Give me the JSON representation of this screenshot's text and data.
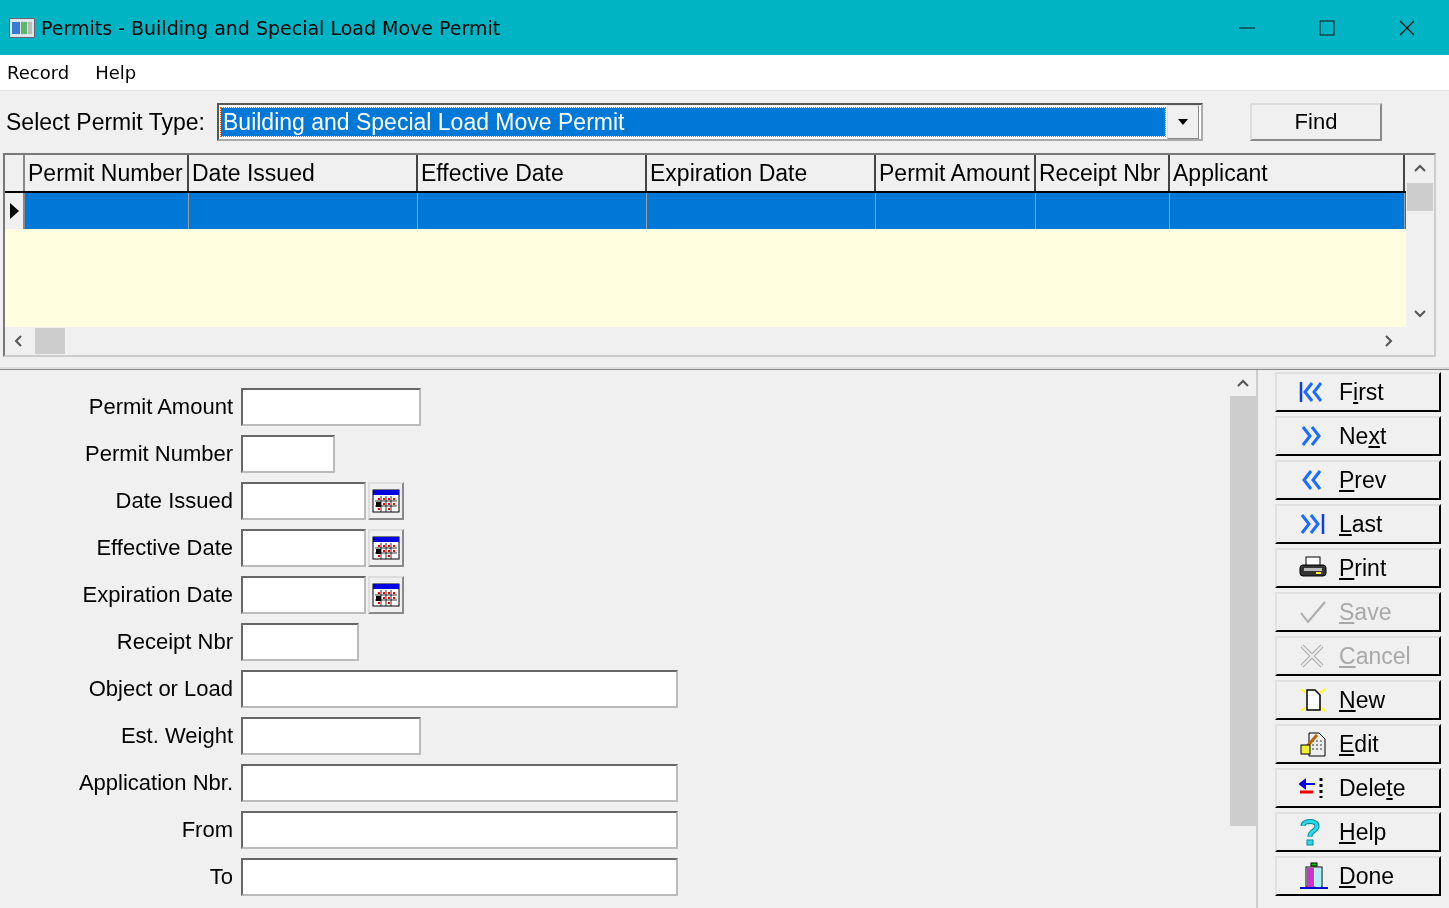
{
  "window": {
    "title": "Permits - Building and Special Load Move Permit"
  },
  "menu": [
    "Record",
    "Help"
  ],
  "permit_type": {
    "label": "Select Permit Type:",
    "value": "Building and Special Load Move Permit"
  },
  "find_button": "Find",
  "table": {
    "columns": [
      "Permit Number",
      "Date Issued",
      "Effective Date",
      "Expiration Date",
      "Permit Amount",
      "Receipt Nbr",
      "Applicant"
    ],
    "rows": [
      {
        "selected": true
      }
    ]
  },
  "form": [
    {
      "label": "Permit Amount",
      "kind": "text"
    },
    {
      "label": "Permit Number",
      "kind": "text"
    },
    {
      "label": "Date Issued",
      "kind": "date"
    },
    {
      "label": "Effective Date",
      "kind": "date"
    },
    {
      "label": "Expiration Date",
      "kind": "date"
    },
    {
      "label": "Receipt Nbr",
      "kind": "text"
    },
    {
      "label": "Object or Load",
      "kind": "text"
    },
    {
      "label": "Est. Weight",
      "kind": "text"
    },
    {
      "label": "Application Nbr.",
      "kind": "text"
    },
    {
      "label": "From",
      "kind": "text"
    },
    {
      "label": "To",
      "kind": "text"
    }
  ],
  "buttons": [
    {
      "kind": "first",
      "pre": "F",
      "key": "i",
      "post": "rst",
      "disabled": false
    },
    {
      "kind": "next",
      "pre": "Ne",
      "key": "x",
      "post": "t",
      "disabled": false
    },
    {
      "kind": "prev",
      "key": "P",
      "post": "rev",
      "disabled": false
    },
    {
      "kind": "last",
      "key": "L",
      "post": "ast",
      "disabled": false
    },
    {
      "kind": "print",
      "key": "P",
      "post": "rint",
      "disabled": false
    },
    {
      "kind": "save",
      "key": "S",
      "post": "ave",
      "disabled": true
    },
    {
      "kind": "cancel",
      "key": "C",
      "post": "ancel",
      "disabled": true
    },
    {
      "kind": "new",
      "key": "N",
      "post": "ew",
      "disabled": false
    },
    {
      "kind": "edit",
      "key": "E",
      "post": "dit",
      "disabled": false
    },
    {
      "kind": "delete",
      "pre": "Dele",
      "key": "t",
      "post": "e",
      "disabled": false
    },
    {
      "kind": "help",
      "key": "H",
      "post": "elp",
      "disabled": false
    },
    {
      "kind": "done",
      "key": "D",
      "post": "one",
      "disabled": false
    }
  ]
}
